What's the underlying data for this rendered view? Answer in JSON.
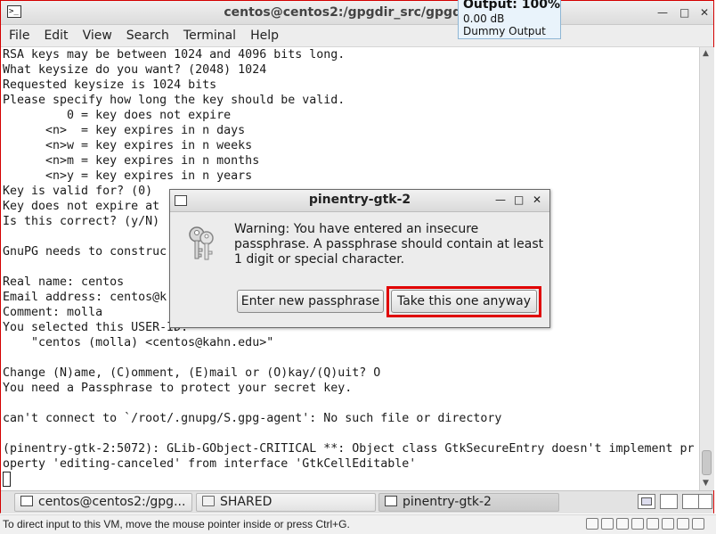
{
  "window": {
    "title": "centos@centos2:/gpgdir_src/gpgdir-1."
  },
  "menu": [
    "File",
    "Edit",
    "View",
    "Search",
    "Terminal",
    "Help"
  ],
  "terminal": {
    "lines": [
      "RSA keys may be between 1024 and 4096 bits long.",
      "What keysize do you want? (2048) 1024",
      "Requested keysize is 1024 bits",
      "Please specify how long the key should be valid.",
      "         0 = key does not expire",
      "      <n>  = key expires in n days",
      "      <n>w = key expires in n weeks",
      "      <n>m = key expires in n months",
      "      <n>y = key expires in n years",
      "Key is valid for? (0)",
      "Key does not expire at",
      "Is this correct? (y/N)",
      "",
      "GnuPG needs to construc",
      "",
      "Real name: centos",
      "Email address: centos@k",
      "Comment: molla",
      "You selected this USER-ID:",
      "    \"centos (molla) <centos@kahn.edu>\"",
      "",
      "Change (N)ame, (C)omment, (E)mail or (O)kay/(Q)uit? O",
      "You need a Passphrase to protect your secret key.",
      "",
      "can't connect to `/root/.gnupg/S.gpg-agent': No such file or directory",
      "",
      "(pinentry-gtk-2:5072): GLib-GObject-CRITICAL **: Object class GtkSecureEntry doesn't implement pr",
      "operty 'editing-canceled' from interface 'GtkCellEditable'"
    ]
  },
  "osd": {
    "line1": "Output: 100%",
    "line2": "0.00 dB",
    "line3": "Dummy Output"
  },
  "dialog": {
    "title": "pinentry-gtk-2",
    "message": "Warning: You have entered an insecure passphrase. A passphrase should contain at least 1 digit or special character.",
    "btn_new": "Enter new passphrase",
    "btn_take": "Take this one anyway"
  },
  "taskbar": {
    "items": [
      "centos@centos2:/gpg...",
      "SHARED",
      "pinentry-gtk-2"
    ]
  },
  "status": {
    "text": "To direct input to this VM, move the mouse pointer inside or press Ctrl+G."
  },
  "icons": {
    "terminal": "terminal-icon",
    "folder": "folder-icon",
    "keys": "keys-icon",
    "minimize": "minimize-icon",
    "maximize": "maximize-icon",
    "close": "close-icon"
  },
  "colors": {
    "highlight": "#e00000",
    "osd_bg": "#e9f3fb"
  }
}
